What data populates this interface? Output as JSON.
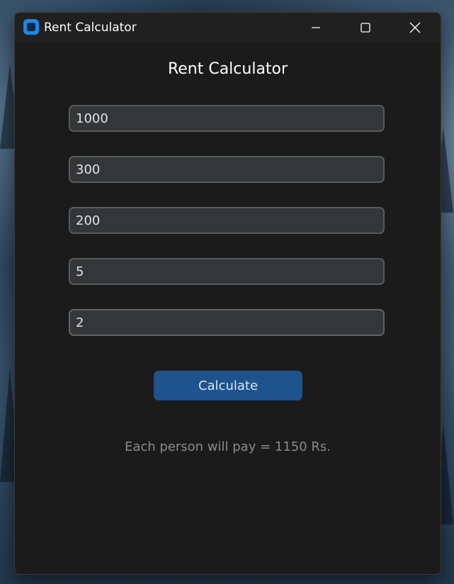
{
  "window": {
    "title": "Rent Calculator"
  },
  "main": {
    "heading": "Rent Calculator",
    "fields": [
      {
        "value": "1000"
      },
      {
        "value": "300"
      },
      {
        "value": "200"
      },
      {
        "value": "5"
      },
      {
        "value": "2"
      }
    ],
    "calculate_label": "Calculate",
    "result_text": "Each person will pay = 1150 Rs."
  },
  "colors": {
    "accent_button": "#1f538d",
    "window_bg": "#1b1b1b",
    "field_bg": "#343638",
    "field_border": "#565b5e",
    "result_text": "#8a8a8a"
  },
  "icons": [
    "app-icon",
    "minimize-icon",
    "maximize-icon",
    "close-icon"
  ]
}
